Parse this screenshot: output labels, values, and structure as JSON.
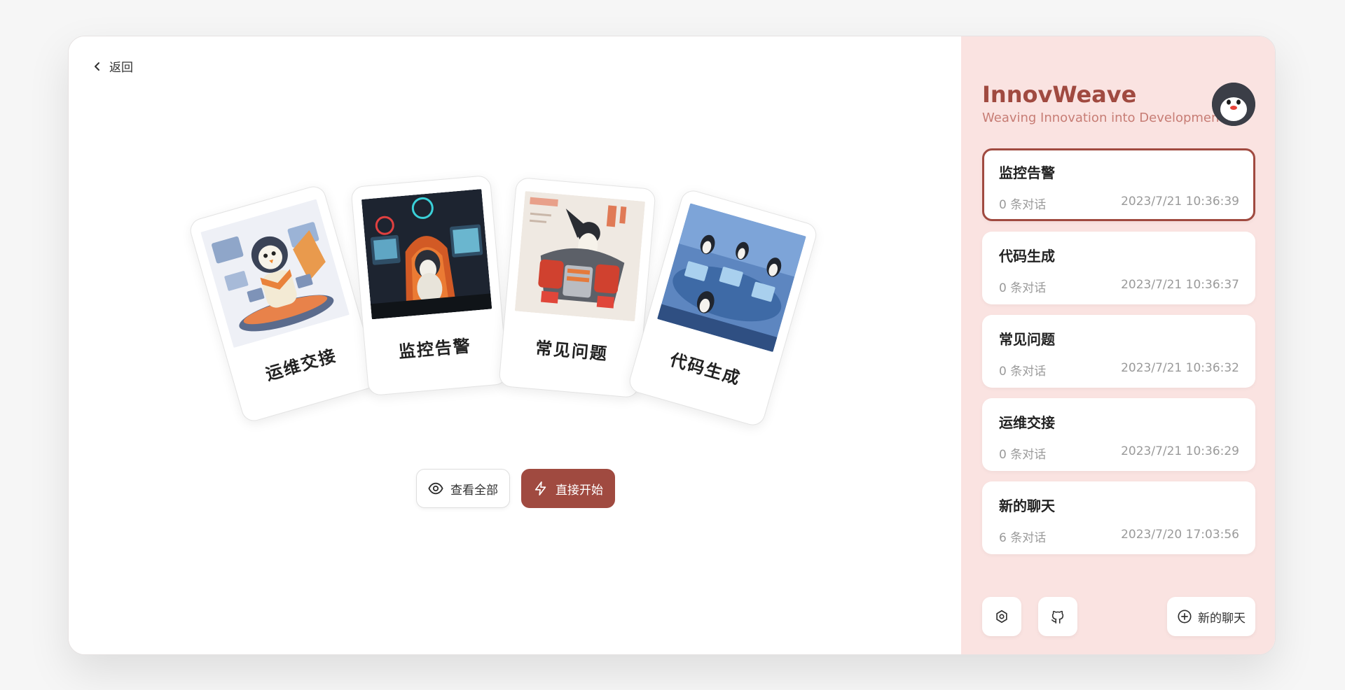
{
  "nav": {
    "back_label": "返回"
  },
  "cards": [
    {
      "label": "运维交接",
      "art": "penguin-operator"
    },
    {
      "label": "监控告警",
      "art": "hooded-penguin-monitors"
    },
    {
      "label": "常见问题",
      "art": "penguin-mech-armor"
    },
    {
      "label": "代码生成",
      "art": "penguins-control-room"
    }
  ],
  "actions": {
    "view_all_label": "查看全部",
    "start_label": "直接开始"
  },
  "brand": {
    "title": "InnovWeave",
    "subtitle": "Weaving Innovation into Development."
  },
  "chats": [
    {
      "title": "监控告警",
      "count": "0 条对话",
      "time": "2023/7/21 10:36:39",
      "active": true
    },
    {
      "title": "代码生成",
      "count": "0 条对话",
      "time": "2023/7/21 10:36:37",
      "active": false
    },
    {
      "title": "常见问题",
      "count": "0 条对话",
      "time": "2023/7/21 10:36:32",
      "active": false
    },
    {
      "title": "运维交接",
      "count": "0 条对话",
      "time": "2023/7/21 10:36:29",
      "active": false
    },
    {
      "title": "新的聊天",
      "count": "6 条对话",
      "time": "2023/7/20 17:03:56",
      "active": false
    }
  ],
  "footer": {
    "new_chat_label": "新的聊天"
  },
  "colors": {
    "accent": "#a04a40",
    "sidebar_bg": "#fae3e1",
    "subtitle": "#c77d75"
  }
}
